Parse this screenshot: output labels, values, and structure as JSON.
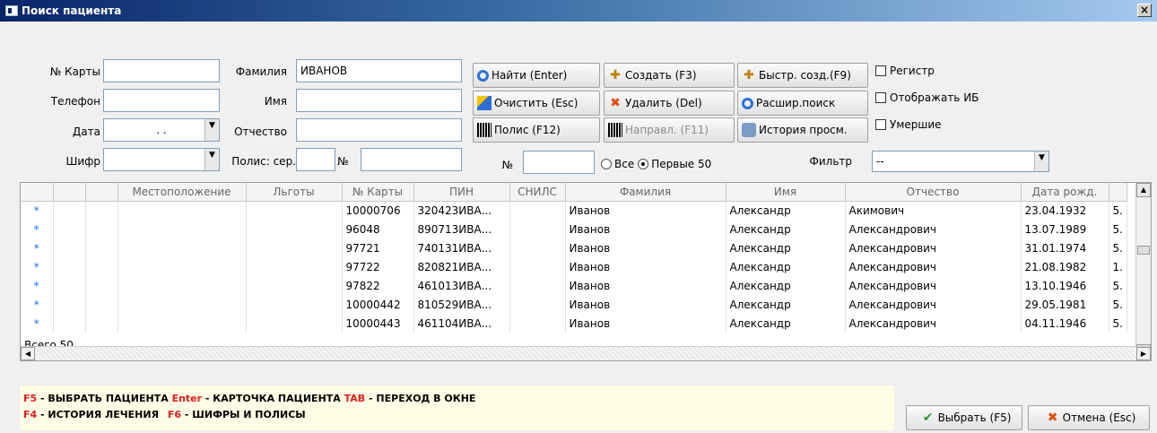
{
  "window": {
    "title": "Поиск пациента",
    "close": "×"
  },
  "search": {
    "card_no_label": "№ Карты",
    "card_no_value": "",
    "phone_label": "Телефон",
    "phone_value": "",
    "date_label": "Дата",
    "date_value": ". .",
    "cipher_label": "Шифр",
    "cipher_value": "",
    "lastname_label": "Фамилия",
    "lastname_value": "ИВАНОВ",
    "firstname_label": "Имя",
    "firstname_value": "",
    "patronymic_label": "Отчество",
    "patronymic_value": "",
    "policy_label": "Полис: сер.",
    "policy_series_value": "",
    "policy_no_label": "№",
    "policy_no_value": "",
    "num_label": "№",
    "num_value": ""
  },
  "buttons": {
    "find": "Найти (Enter)",
    "create": "Создать (F3)",
    "quick_create": "Быстр. созд.(F9)",
    "clear": "Очистить (Esc)",
    "delete": "Удалить (Del)",
    "ext_search": "Расшир.поиск",
    "policy": "Полис (F12)",
    "referral": "Направл. (F11)",
    "view_history": "История просм."
  },
  "checkboxes": {
    "register": "Регистр",
    "show_ib": "Отображать ИБ",
    "deceased": "Умершие"
  },
  "radio": {
    "all": "Все",
    "first50": "Первые 50",
    "selected": "first50"
  },
  "filter": {
    "label": "Фильтр",
    "value": "--"
  },
  "table": {
    "columns": [
      "",
      "",
      "",
      "Местоположение",
      "Льготы",
      "№ Карты",
      "ПИН",
      "СНИЛС",
      "Фамилия",
      "Имя",
      "Отчество",
      "Дата рожд.",
      ""
    ],
    "rows": [
      {
        "mark": "*",
        "card": "10000706",
        "pin": "320423ИВА...",
        "snils": "",
        "last": "Иванов",
        "first": "Александр",
        "patr": "Акимович",
        "dob": "23.04.1932",
        "extra": "5."
      },
      {
        "mark": "*",
        "card": "96048",
        "pin": "890713ИВА...",
        "snils": "",
        "last": "Иванов",
        "first": "Александр",
        "patr": "Александрович",
        "dob": "13.07.1989",
        "extra": "5."
      },
      {
        "mark": "*",
        "card": "97721",
        "pin": "740131ИВА...",
        "snils": "",
        "last": "Иванов",
        "first": "Александр",
        "patr": "Александрович",
        "dob": "31.01.1974",
        "extra": "5."
      },
      {
        "mark": "*",
        "card": "97722",
        "pin": "820821ИВА...",
        "snils": "",
        "last": "Иванов",
        "first": "Александр",
        "patr": "Александрович",
        "dob": "21.08.1982",
        "extra": "1."
      },
      {
        "mark": "*",
        "card": "97822",
        "pin": "461013ИВА...",
        "snils": "",
        "last": "Иванов",
        "first": "Александр",
        "patr": "Александрович",
        "dob": "13.10.1946",
        "extra": "5."
      },
      {
        "mark": "*",
        "card": "10000442",
        "pin": "810529ИВА...",
        "snils": "",
        "last": "Иванов",
        "first": "Александр",
        "patr": "Александрович",
        "dob": "29.05.1981",
        "extra": "5."
      },
      {
        "mark": "*",
        "card": "10000443",
        "pin": "461104ИВА...",
        "snils": "",
        "last": "Иванов",
        "first": "Александр",
        "patr": "Александрович",
        "dob": "04.11.1946",
        "extra": "5."
      }
    ],
    "total": "Всего 50"
  },
  "hints": {
    "k1": "F5",
    "t1": " - ВЫБРАТЬ ПАЦИЕНТА ",
    "k2": "Enter",
    "t2": " - КАРТОЧКА ПАЦИЕНТА ",
    "k3": "TAB",
    "t3": " - ПЕРЕХОД В ОКНЕ",
    "k4": "F4",
    "t4": " - ИСТОРИЯ ЛЕЧЕНИЯ ",
    "k5": "F6",
    "t5": " - ШИФРЫ И ПОЛИСЫ"
  },
  "footer": {
    "select": "Выбрать (F5)",
    "cancel": "Отмена (Esc)"
  }
}
